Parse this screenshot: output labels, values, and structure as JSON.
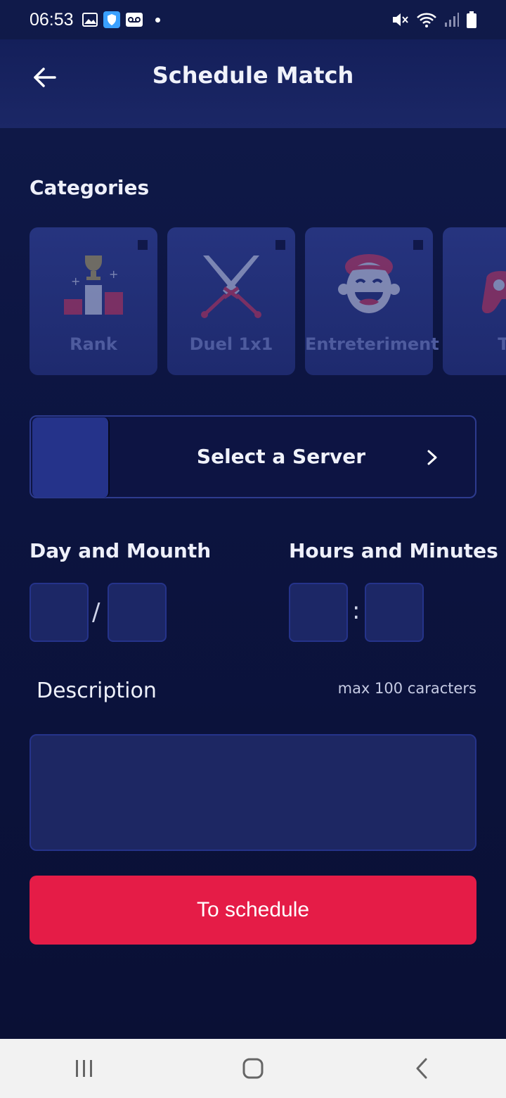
{
  "status_bar": {
    "time": "06:53"
  },
  "header": {
    "title": "Schedule Match"
  },
  "categories": {
    "title": "Categories",
    "items": [
      {
        "label": "Rank",
        "icon": "podium-icon"
      },
      {
        "label": "Duel 1x1",
        "icon": "crossed-swords-icon"
      },
      {
        "label": "Entreteriment",
        "icon": "laughing-face-icon"
      },
      {
        "label": "Tr",
        "icon": "gamepad-icon"
      }
    ]
  },
  "server": {
    "label": "Select a Server"
  },
  "date": {
    "title": "Day and Mounth",
    "separator": "/"
  },
  "time": {
    "title": "Hours and Minutes",
    "separator": ":"
  },
  "description": {
    "label": "Description",
    "max_hint": "max 100 caracters",
    "value": ""
  },
  "submit": {
    "label": "To schedule"
  },
  "colors": {
    "accent": "#e51c47",
    "background": "#0e1540",
    "card": "#26347f"
  }
}
